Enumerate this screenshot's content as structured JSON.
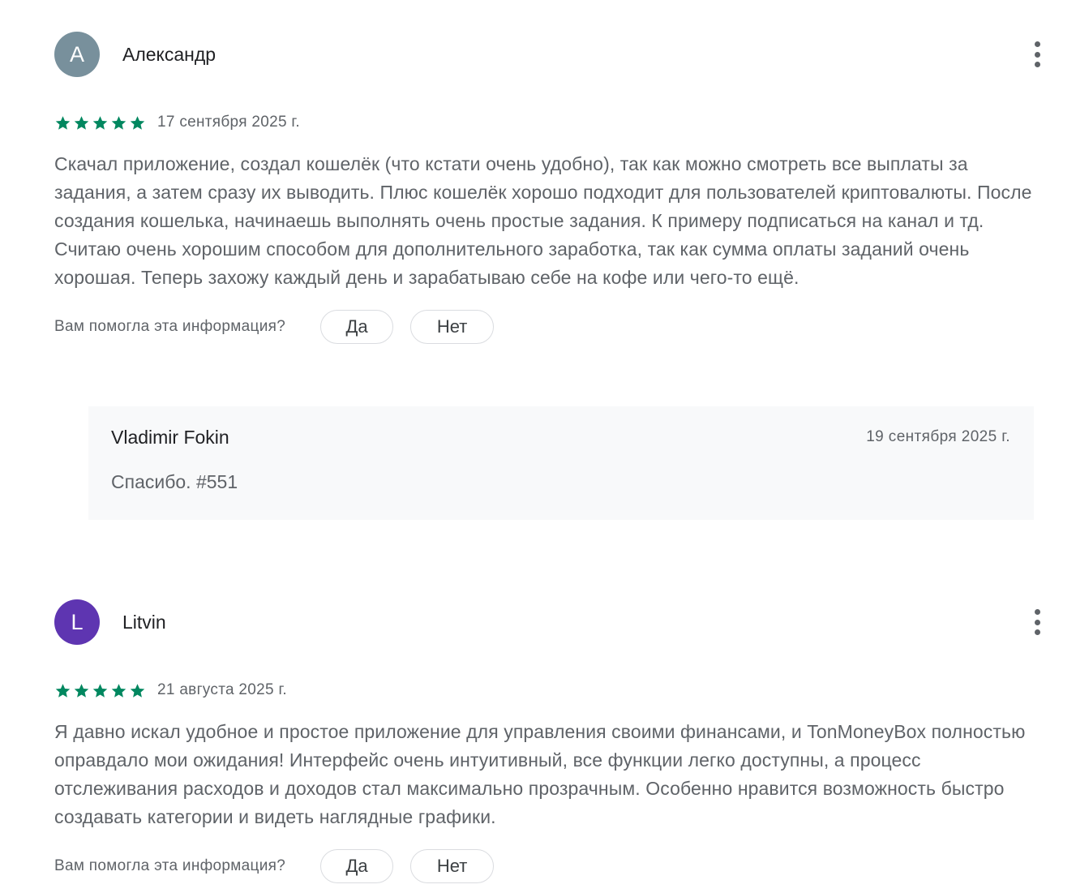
{
  "reviews": [
    {
      "avatar_letter": "A",
      "avatar_color": "#78909c",
      "author": "Александр",
      "rating": 5,
      "date": "17 сентября 2025 г.",
      "text": "Скачал приложение, создал кошелёк (что кстати очень удобно), так как можно смотреть все выплаты за задания, а затем сразу их выводить. Плюс кошелёк хорошо подходит для пользователей криптовалюты. После создания кошелька, начинаешь выполнять очень простые задания. К примеру подписаться на канал и тд. Считаю очень хорошим способом для дополнительного заработка, так как сумма оплаты заданий очень хорошая. Теперь захожу каждый день и зарабатываю себе на кофе или чего-то ещё.",
      "helpful_question": "Вам помогла эта информация?",
      "yes_label": "Да",
      "no_label": "Нет",
      "reply": {
        "author": "Vladimir Fokin",
        "date": "19 сентября 2025 г.",
        "text": "Спасибо. #551"
      }
    },
    {
      "avatar_letter": "L",
      "avatar_color": "#5e35b1",
      "author": "Litvin",
      "rating": 5,
      "date": "21 августа 2025 г.",
      "text": "Я давно искал удобное и простое приложение для управления своими финансами, и TonMoneyBox полностью оправдало мои ожидания! Интерфейс очень интуитивный, все функции легко доступны, а процесс отслеживания расходов и доходов стал максимально прозрачным. Особенно нравится возможность быстро создавать категории и видеть наглядные графики.",
      "helpful_question": "Вам помогла эта информация?",
      "yes_label": "Да",
      "no_label": "Нет"
    }
  ],
  "colors": {
    "star": "#01875f",
    "muted_text": "#5f6368",
    "reply_bg": "#f8f9fa"
  },
  "icons": {
    "more": "more-vert-icon",
    "star": "star-icon"
  }
}
